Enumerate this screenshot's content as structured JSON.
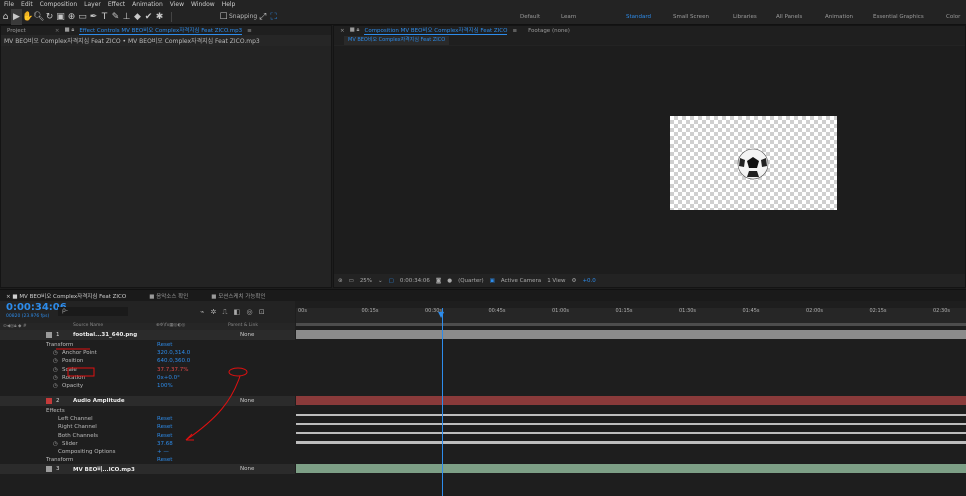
{
  "menu": [
    "File",
    "Edit",
    "Composition",
    "Layer",
    "Effect",
    "Animation",
    "View",
    "Window",
    "Help"
  ],
  "toolbar": {
    "snapping_label": "Snapping"
  },
  "workspaces": [
    "Default",
    "Learn",
    "Standard",
    "Small Screen",
    "Libraries",
    "All Panels",
    "Animation",
    "Essential Graphics",
    "Color"
  ],
  "active_workspace": "Standard",
  "project_panel": {
    "tab_project": "Project",
    "tab_effect_controls": "Effect Controls MV BEO비오 Complex자격지심 Feat ZICO.mp3",
    "header_path": "MV BEO비오 Complex자격지심 Feat ZICO • MV BEO비오 Complex자격지심 Feat ZICO.mp3"
  },
  "composition_panel": {
    "tab": "Composition MV BEO비오 Complex자격지심 Feat ZICO",
    "footage_tab": "Footage (none)",
    "sub_tab": "MV BEO비오 Complex자격지심 Feat ZICO",
    "zoom": "25%",
    "timecode": "0:00:34:06",
    "resolution": "(Quarter)",
    "camera": "Active Camera",
    "views": "1 View",
    "exposure": "+0.0"
  },
  "timeline": {
    "tabs": [
      "MV BEO비오 Complex자격지심 Feat ZICO",
      "음악소스 확인",
      "모션스케치 가능확인"
    ],
    "current_time": "0:00:34:06",
    "frame_info": "00820 (23.976 fps)",
    "search_placeholder": "ρ-",
    "col_source": "Source Name",
    "col_parent": "Parent & Link",
    "ruler": [
      "00s",
      "00:15s",
      "00:30s",
      "00:45s",
      "01:00s",
      "01:15s",
      "01:30s",
      "01:45s",
      "02:00s",
      "02:15s",
      "02:30s"
    ],
    "rows": [
      {
        "num": "1",
        "name": "footbal...31_640.png",
        "parent": "None",
        "kind": "layer"
      },
      {
        "name": "Transform",
        "value": "Reset",
        "kind": "group"
      },
      {
        "name": "Anchor Point",
        "value": "320.0,314.0",
        "kind": "prop"
      },
      {
        "name": "Position",
        "value": "640.0,360.0",
        "kind": "prop"
      },
      {
        "name": "Scale",
        "value": "37.7,37.7%",
        "kind": "prop-red"
      },
      {
        "name": "Rotation",
        "value": "0x+0.0°",
        "kind": "prop"
      },
      {
        "name": "Opacity",
        "value": "100%",
        "kind": "prop"
      },
      {
        "num": "2",
        "name": "Audio Amplitude",
        "parent": "None",
        "kind": "layer"
      },
      {
        "name": "Effects",
        "value": "",
        "kind": "group"
      },
      {
        "name": "Left Channel",
        "value": "Reset",
        "kind": "sub"
      },
      {
        "name": "Right Channel",
        "value": "Reset",
        "kind": "sub"
      },
      {
        "name": "Both Channels",
        "value": "Reset",
        "kind": "sub"
      },
      {
        "name": "Slider",
        "value": "37.68",
        "kind": "prop"
      },
      {
        "name": "Compositing Options",
        "value": "+ —",
        "kind": "sub"
      },
      {
        "name": "Transform",
        "value": "Reset",
        "kind": "group"
      },
      {
        "num": "3",
        "name": "MV BEO비...ICO.mp3",
        "parent": "None",
        "kind": "layer"
      }
    ]
  }
}
